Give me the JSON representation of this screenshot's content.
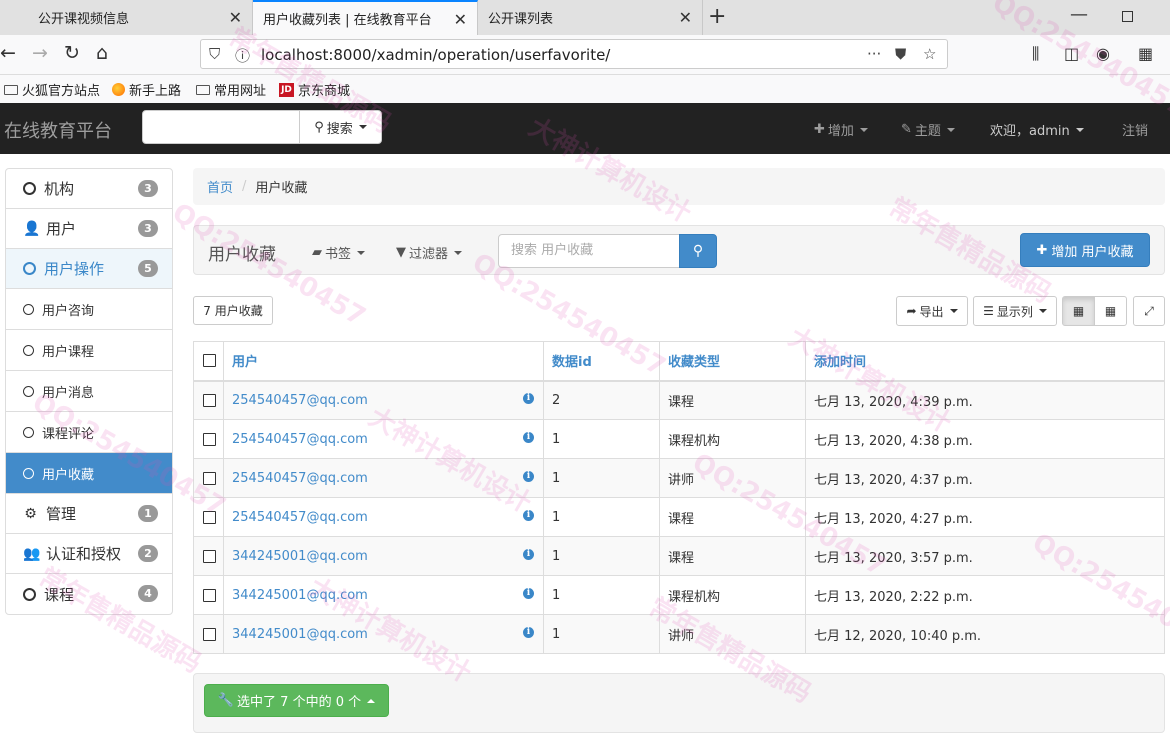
{
  "browser": {
    "tabs": [
      {
        "title": "公开课视频信息"
      },
      {
        "title": "用户收藏列表 | 在线教育平台"
      },
      {
        "title": "公开课列表"
      }
    ],
    "url": "localhost:8000/xadmin/operation/userfavorite/",
    "bookmarks": [
      {
        "label": "火狐官方站点",
        "icon": "folder-icon"
      },
      {
        "label": "新手上路",
        "icon": "firefox-icon"
      },
      {
        "label": "常用网址",
        "icon": "folder-icon"
      },
      {
        "label": "京东商城",
        "icon": "jd-icon"
      }
    ],
    "jd_icon_text": "JD"
  },
  "app": {
    "brand": "在线教育平台",
    "search_button": "搜索",
    "nav_add": "增加",
    "nav_theme": "主题",
    "nav_user": "欢迎，admin",
    "nav_logout": "注销"
  },
  "sidebar": {
    "items": [
      {
        "label": "机构",
        "badge": "3"
      },
      {
        "label": "用户",
        "badge": "3"
      },
      {
        "label": "用户操作",
        "badge": "5"
      },
      {
        "label": "用户咨询"
      },
      {
        "label": "用户课程"
      },
      {
        "label": "用户消息"
      },
      {
        "label": "课程评论"
      },
      {
        "label": "用户收藏"
      },
      {
        "label": "管理",
        "badge": "1"
      },
      {
        "label": "认证和授权",
        "badge": "2"
      },
      {
        "label": "课程",
        "badge": "4"
      }
    ]
  },
  "breadcrumb": {
    "home": "首页",
    "sep": "/",
    "current": "用户收藏"
  },
  "toolbar": {
    "title": "用户收藏",
    "bookmarks": "书签",
    "filters": "过滤器",
    "search_placeholder": "搜索 用户收藏",
    "add_label": "增加 用户收藏"
  },
  "list_tools": {
    "count": "7 用户收藏",
    "export": "导出",
    "columns": "显示列"
  },
  "table": {
    "columns": [
      "用户",
      "数据id",
      "收藏类型",
      "添加时间"
    ],
    "rows": [
      {
        "user": "254540457@qq.com",
        "fav_id": "2",
        "type": "课程",
        "time": "七月 13, 2020, 4:39 p.m."
      },
      {
        "user": "254540457@qq.com",
        "fav_id": "1",
        "type": "课程机构",
        "time": "七月 13, 2020, 4:38 p.m."
      },
      {
        "user": "254540457@qq.com",
        "fav_id": "1",
        "type": "讲师",
        "time": "七月 13, 2020, 4:37 p.m."
      },
      {
        "user": "254540457@qq.com",
        "fav_id": "1",
        "type": "课程",
        "time": "七月 13, 2020, 4:27 p.m."
      },
      {
        "user": "344245001@qq.com",
        "fav_id": "1",
        "type": "课程",
        "time": "七月 13, 2020, 3:57 p.m."
      },
      {
        "user": "344245001@qq.com",
        "fav_id": "1",
        "type": "课程机构",
        "time": "七月 13, 2020, 2:22 p.m."
      },
      {
        "user": "344245001@qq.com",
        "fav_id": "1",
        "type": "讲师",
        "time": "七月 12, 2020, 10:40 p.m."
      }
    ],
    "info_glyph": "i"
  },
  "footer": {
    "action_label": "选中了 7 个中的 0 个"
  },
  "watermarks": [
    "QQ:254540457",
    "常年售精品源码",
    "大神计算机设计"
  ],
  "colors": {
    "primary": "#428bca",
    "success": "#5cb85c",
    "navbar": "#222222",
    "watermark": "#dd50b4"
  }
}
